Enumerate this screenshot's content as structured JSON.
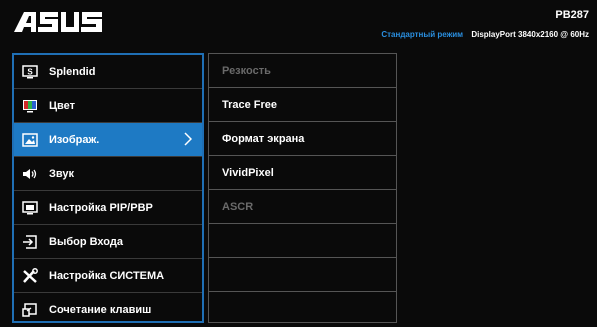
{
  "header": {
    "brand": "ASUS",
    "model": "PB287",
    "mode": "Стандартный режим",
    "input": "DisplayPort",
    "resolution": "3840x2160 @ 60Hz"
  },
  "menu": {
    "items": [
      {
        "label": "Splendid",
        "icon": "splendid-icon"
      },
      {
        "label": "Цвет",
        "icon": "color-icon"
      },
      {
        "label": "Изображ.",
        "icon": "image-icon",
        "active": true
      },
      {
        "label": "Звук",
        "icon": "speaker-icon"
      },
      {
        "label": "Настройка PIP/PBP",
        "icon": "pip-icon"
      },
      {
        "label": "Выбор Входа",
        "icon": "input-select-icon"
      },
      {
        "label": "Настройка СИСТЕМА",
        "icon": "tools-icon"
      },
      {
        "label": "Сочетание клавиш",
        "icon": "shortcut-icon"
      }
    ],
    "active_color": "#1e7ac4",
    "border_color": "#1f6fb5"
  },
  "submenu": {
    "items": [
      {
        "label": "Резкость",
        "enabled": false
      },
      {
        "label": "Trace Free",
        "enabled": true
      },
      {
        "label": "Формат экрана",
        "enabled": true
      },
      {
        "label": "VividPixel",
        "enabled": true
      },
      {
        "label": "ASCR",
        "enabled": false
      },
      {
        "label": ""
      },
      {
        "label": ""
      },
      {
        "label": ""
      }
    ]
  }
}
